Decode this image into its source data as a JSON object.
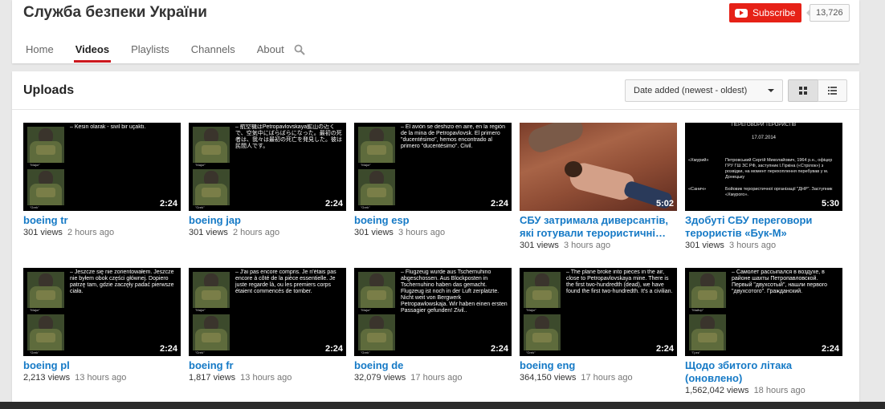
{
  "channel": {
    "title": "Служба безпеки України",
    "subscribe_label": "Subscribe",
    "subscriber_count": "13,726"
  },
  "tabs": [
    {
      "label": "Home"
    },
    {
      "label": "Videos"
    },
    {
      "label": "Playlists"
    },
    {
      "label": "Channels"
    },
    {
      "label": "About"
    }
  ],
  "active_tab": "Videos",
  "uploads": {
    "title": "Uploads",
    "sort_label": "Date added (newest - oldest)"
  },
  "videos": [
    {
      "title": "boeing tr",
      "views": "301 views",
      "ago": "2 hours ago",
      "duration": "2:24",
      "caption": "– Kesin olarak - sivil bir uçaktı.",
      "label_top": "\"Major\"",
      "label_bottom": "\"Grek\""
    },
    {
      "title": "boeing jap",
      "views": "301 views",
      "ago": "2 hours ago",
      "duration": "2:24",
      "caption": "– 航空機はPetropavlovskaya鉱山の近くで、空気中にばらばらになった。最初の死者は、我々は最初の死亡を発見した。彼は民間人です。",
      "label_top": "\"Major\"",
      "label_bottom": "\"Grek\""
    },
    {
      "title": "boeing esp",
      "views": "301 views",
      "ago": "3 hours ago",
      "duration": "2:24",
      "caption": "– El avión se deshizo en aire, en la región de la mina de Petropavlovsk. El primero \"ducentésimo\", hemos encontrado al primero \"ducentésimo\". Civil.",
      "label_top": "\"Major\"",
      "label_bottom": "\"Grek\""
    },
    {
      "title": "СБУ затримала диверсантів, які готували терористичні…",
      "views": "301 views",
      "ago": "3 hours ago",
      "duration": "5:02"
    },
    {
      "title": "Здобуті СБУ переговори терористів «Бук-М»",
      "views": "301 views",
      "ago": "3 hours ago",
      "duration": "5:30",
      "doc_title": "ПЕРЕГОВОРИ ТЕРОРИСТІВ",
      "doc_date": "17.07.2014",
      "doc_tag1": "«Хмурий»",
      "doc_text1": "Петровський Сергій Миколайович, 1964 р.н., офіцер ГРУ ГШ ЗС РФ, заступник І.Гіркіна («Стрілок») з розвідки, на момент перехоплення перебував у м. Донецьку",
      "doc_tag2": "«Санич»",
      "doc_text2": "Бойовик терористичної організації \"ДНР\". Заступник «Хмурого»."
    },
    {
      "title": "boeing pl",
      "views": "2,213 views",
      "ago": "13 hours ago",
      "duration": "2:24",
      "caption": "– Jeszcze się nie zorientowałem. Jeszcze nie byłem obok części głównej. Dopiero patrzę tam, gdzie zaczęły padać pierwsze ciała.",
      "label_top": "\"Major\"",
      "label_bottom": "\"Grek\""
    },
    {
      "title": "boeing fr",
      "views": "1,817 views",
      "ago": "13 hours ago",
      "duration": "2:24",
      "caption": "– J'ai pas encore compris. Je n'étais pas encore à côté de la pièce essentielle. Je juste regarde là, ou les premiers corps étaient commencés de tomber.",
      "label_top": "\"Major\"",
      "label_bottom": "\"Grek\""
    },
    {
      "title": "boeing de",
      "views": "32,079 views",
      "ago": "17 hours ago",
      "duration": "2:24",
      "caption": "– Flugzeug wurde aus Tschernuhino abgeschossen. Aus Blockposten in Tschernuhino haben das gemacht. Flugzeug ist noch in der Luft zerplatzte. Nicht weit von Bergwerk Petropawlowskaja. Wir haben einen ersten Passagier gefunden! Zivil..",
      "label_top": "\"Major\"",
      "label_bottom": "\"Grek\""
    },
    {
      "title": "boeing eng",
      "views": "364,150 views",
      "ago": "17 hours ago",
      "duration": "2:24",
      "caption": "– The plane broke into pieces in the air, close to Petropavlovskaya mine. There is the first two-hundredth (dead), we have found the first two-hundredth. It's a civilian.",
      "label_top": "\"Major\"",
      "label_bottom": "\"Grek\""
    },
    {
      "title": "Щодо збитого літака (оновлено)",
      "views": "1,562,042 views",
      "ago": "18 hours ago",
      "duration": "2:24",
      "caption": "– Самолет рассыпался в воздухе, в районе шахты Петропавловской. Первый \"двухсотый\", нашли первого \"двухсотого\". Гражданский.",
      "label_top": "\"Майор\"",
      "label_bottom": "\"Грек\""
    }
  ],
  "colors": {
    "accent_red": "#cc181e",
    "subscribe_red": "#e62117",
    "link_blue": "#167ac6"
  },
  "icons": [
    "search-icon",
    "youtube-logo-icon",
    "grid-view-icon",
    "list-view-icon",
    "dropdown-caret-icon"
  ]
}
